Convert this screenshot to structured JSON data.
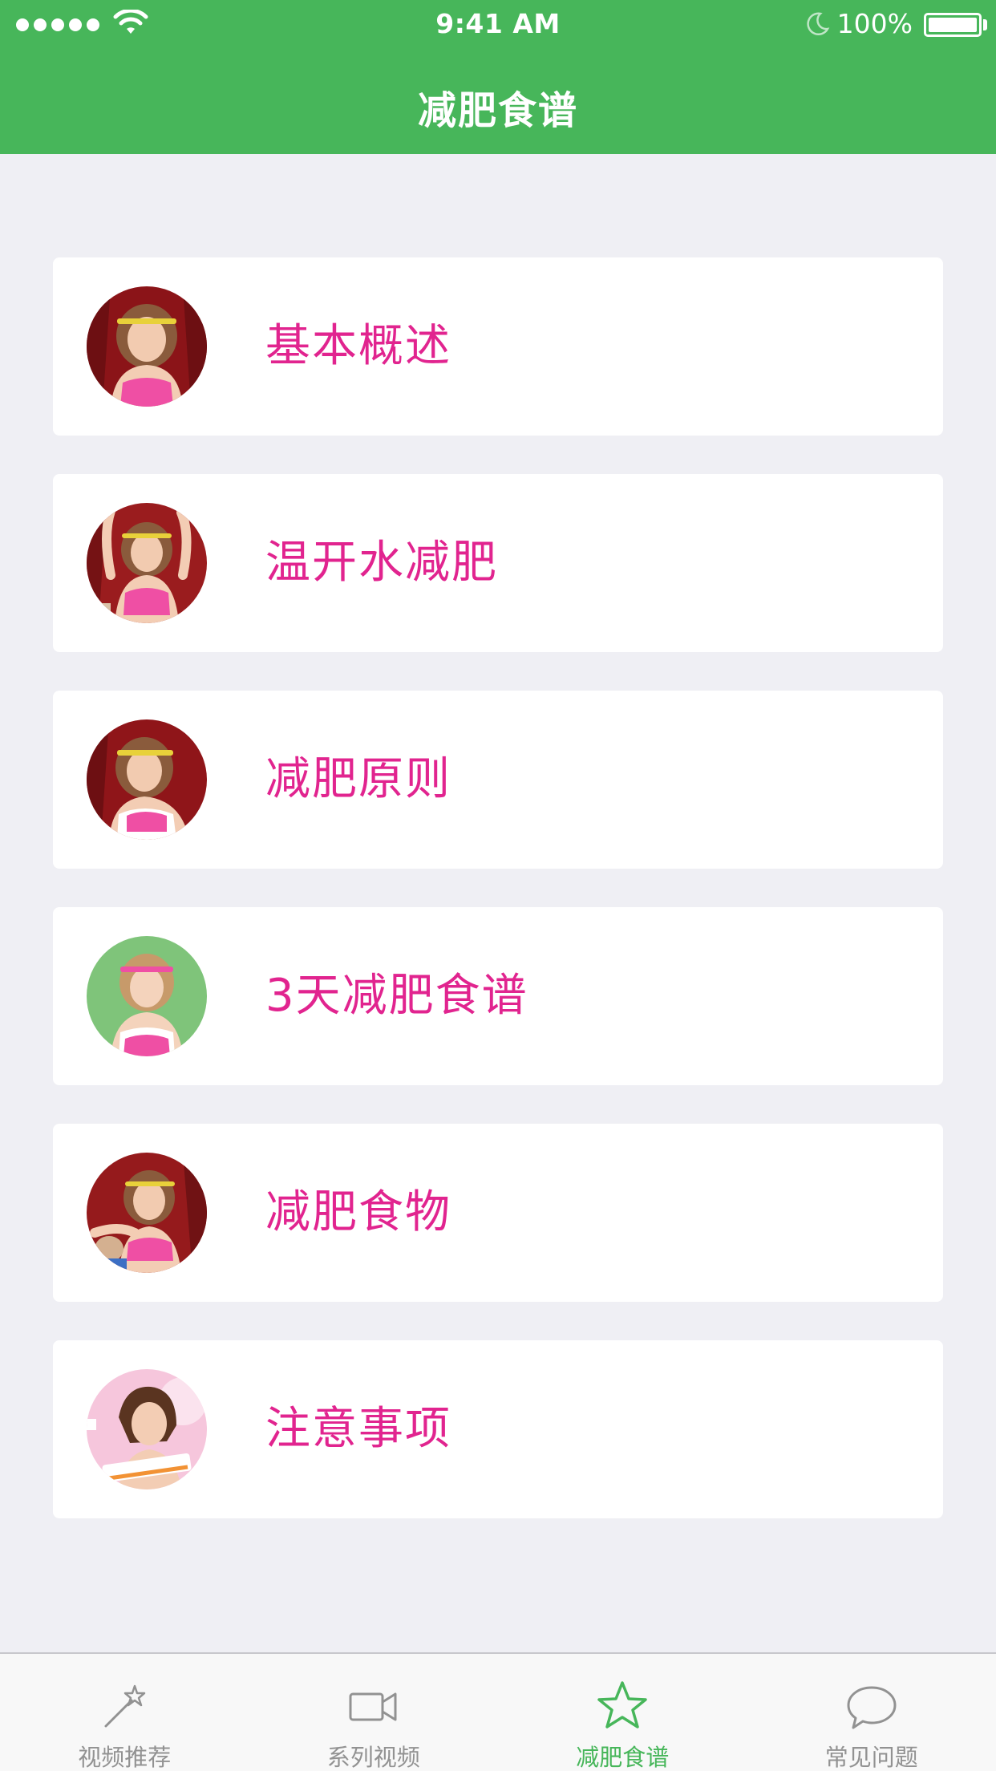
{
  "status_bar": {
    "time": "9:41 AM",
    "battery": "100%"
  },
  "nav": {
    "title": "减肥食谱"
  },
  "items": [
    {
      "label": "基本概述",
      "avatar_icon": "fitness-girl-red-bg",
      "bg": "#8b1418"
    },
    {
      "label": "温开水减肥",
      "avatar_icon": "fitness-girl-arms-up",
      "bg": "#9a1c1e"
    },
    {
      "label": "减肥原则",
      "avatar_icon": "fitness-girl-red-bg",
      "bg": "#8f1519"
    },
    {
      "label": "3天减肥食谱",
      "avatar_icon": "fitness-girl-green-bg",
      "bg": "#7fc47a"
    },
    {
      "label": "减肥食物",
      "avatar_icon": "fitness-girl-red-bg",
      "bg": "#951a1c"
    },
    {
      "label": "注意事项",
      "avatar_icon": "before-after-girl",
      "bg": "#f6c6dc"
    }
  ],
  "tabs": [
    {
      "label": "视频推荐",
      "icon": "magic-wand-icon",
      "active": false
    },
    {
      "label": "系列视频",
      "icon": "video-camera-icon",
      "active": false
    },
    {
      "label": "减肥食谱",
      "icon": "star-icon",
      "active": true
    },
    {
      "label": "常见问题",
      "icon": "chat-bubble-icon",
      "active": false
    }
  ],
  "colors": {
    "nav_green": "#47b65a",
    "item_text": "#e1248f",
    "page_bg": "#efeff4",
    "tab_inactive": "#929292"
  }
}
